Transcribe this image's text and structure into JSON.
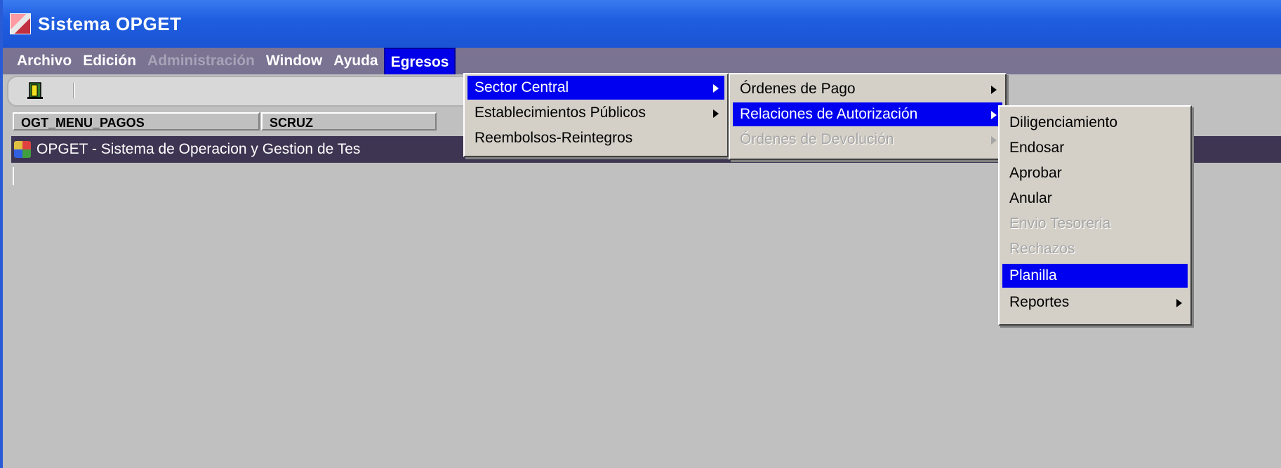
{
  "window": {
    "title": "Sistema OPGET"
  },
  "menubar": {
    "items": [
      {
        "label": "Archivo"
      },
      {
        "label": "Edición"
      },
      {
        "label": "Administración"
      },
      {
        "label": "Window"
      },
      {
        "label": "Ayuda"
      },
      {
        "label": "Egresos"
      }
    ]
  },
  "toolbar": {
    "exit_icon": "exit-door-icon"
  },
  "status": {
    "module": "OGT_MENU_PAGOS",
    "user": "SCRUZ"
  },
  "inner_frame": {
    "title": "OPGET - Sistema de Operacion y Gestion de Tes"
  },
  "menu_egresos": {
    "items": [
      {
        "label": "Sector Central",
        "highlighted": true
      },
      {
        "label": "Establecimientos Públicos"
      },
      {
        "label": "Reembolsos-Reintegros"
      }
    ]
  },
  "menu_sector_central": {
    "items": [
      {
        "label": "Órdenes de Pago"
      },
      {
        "label": "Relaciones de Autorización",
        "highlighted": true
      },
      {
        "label": "Órdenes de Devolución",
        "disabled": true
      }
    ]
  },
  "menu_relaciones": {
    "items": [
      {
        "label": "Diligenciamiento"
      },
      {
        "label": "Endosar"
      },
      {
        "label": "Aprobar"
      },
      {
        "label": "Anular"
      },
      {
        "label": "Envio Tesoreria",
        "disabled": true
      },
      {
        "label": "Rechazos",
        "disabled": true
      },
      {
        "label": "Planilla",
        "highlighted": true
      },
      {
        "label": "Reportes"
      }
    ]
  },
  "colors": {
    "title_bar": "#1f5ee0",
    "menu_bar": "#7a7392",
    "highlight": "#0000f0",
    "inner_title": "#3d3552"
  }
}
